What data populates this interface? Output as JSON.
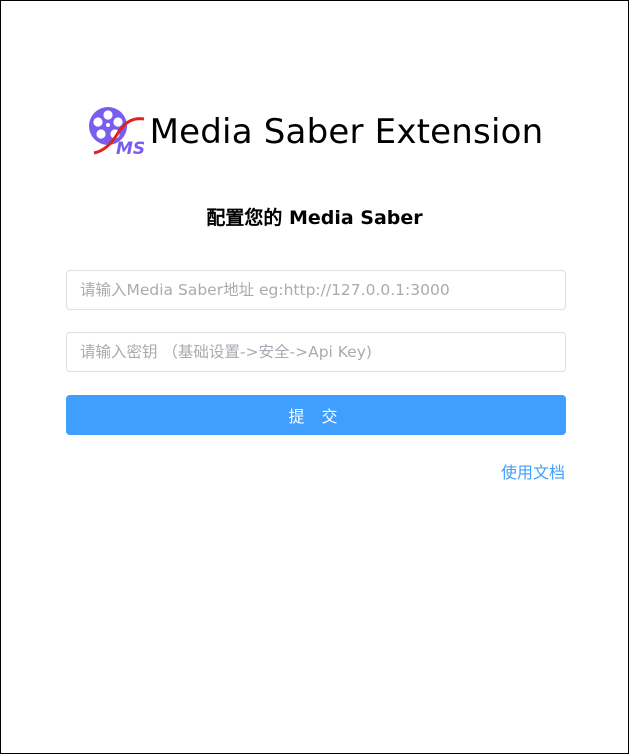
{
  "brand": {
    "logo_text": "MS",
    "title": "Media Saber Extension"
  },
  "form": {
    "heading": "配置您的 Media Saber",
    "address_placeholder": "请输入Media Saber地址 eg:http://127.0.0.1:3000",
    "key_placeholder": "请输入密钥 （基础设置->安全->Api Key)",
    "submit_label": "提 交",
    "docs_link": "使用文档"
  },
  "colors": {
    "accent": "#409eff",
    "logo_purple": "#7b5cf0",
    "logo_red": "#e0231e"
  }
}
